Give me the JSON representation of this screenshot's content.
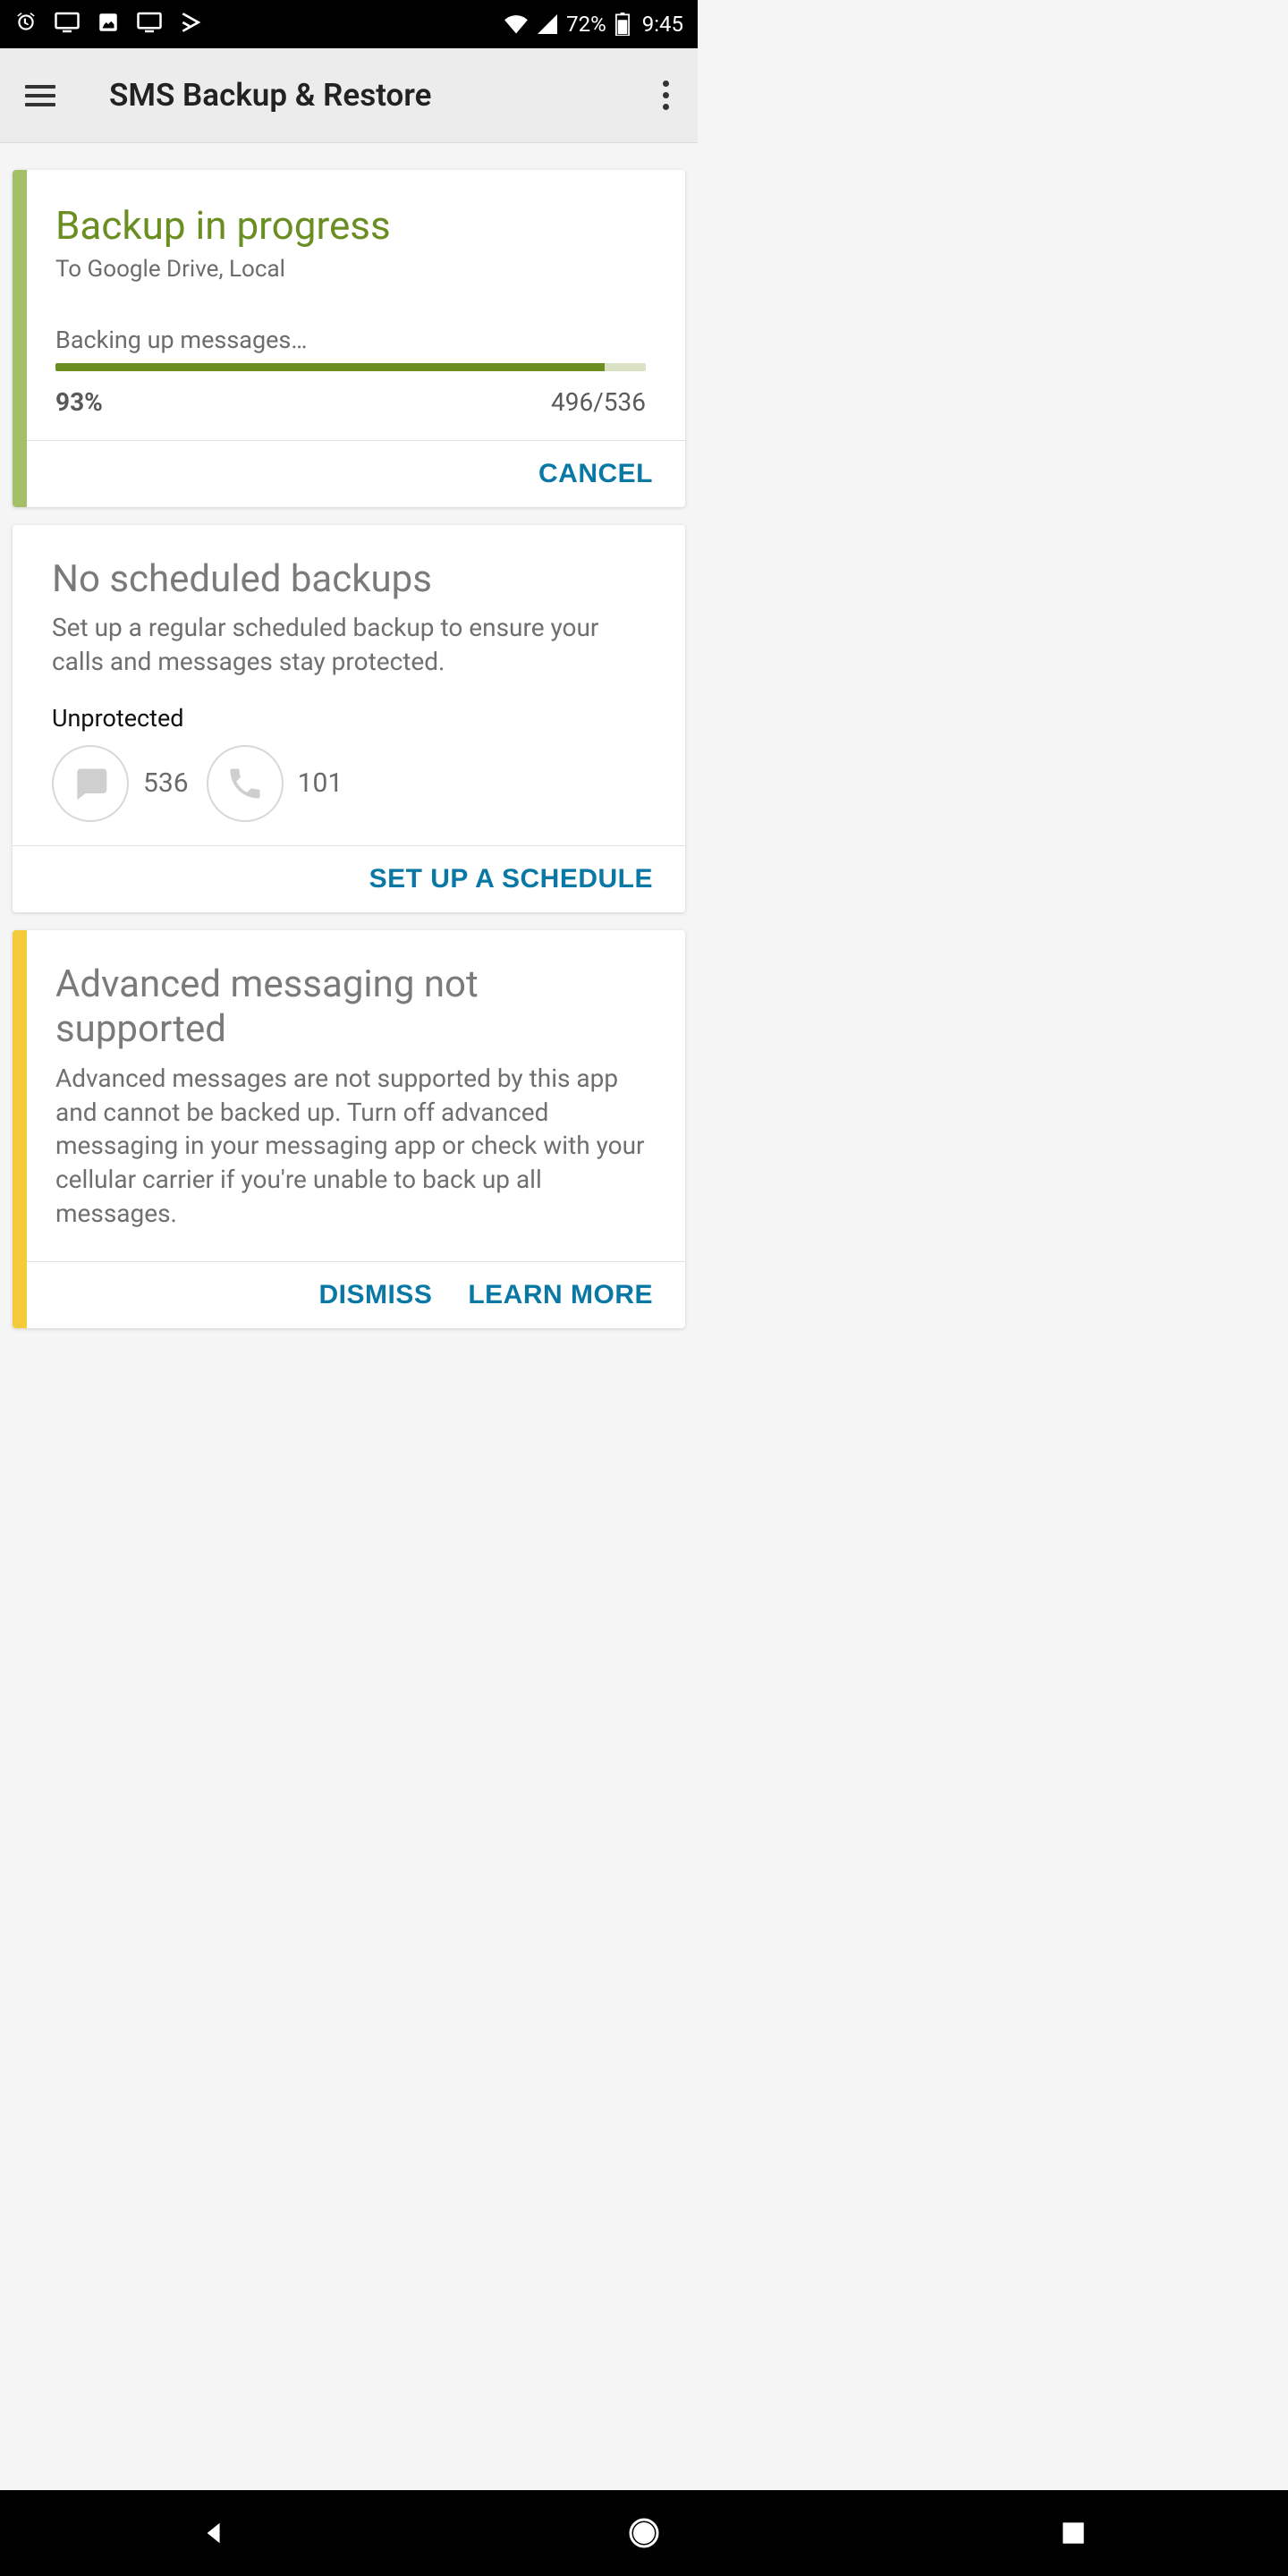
{
  "status": {
    "battery_pct": "72%",
    "time": "9:45"
  },
  "appbar": {
    "title": "SMS Backup & Restore"
  },
  "backup_card": {
    "title": "Backup in progress",
    "destination": "To Google Drive, Local",
    "state_text": "Backing up messages…",
    "percent": "93%",
    "progress_value": 93,
    "count_text": "496/536",
    "cancel_label": "CANCEL"
  },
  "schedule_card": {
    "title": "No scheduled backups",
    "description": "Set up a regular scheduled backup to ensure your calls and messages stay protected.",
    "unprotected_label": "Unprotected",
    "messages_count": "536",
    "calls_count": "101",
    "action_label": "SET UP A SCHEDULE"
  },
  "advanced_card": {
    "title": "Advanced messaging not supported",
    "description": "Advanced messages are not supported by this app and cannot be backed up. Turn off advanced messaging in your messaging app or check with your cellular carrier if you're unable to back up all messages.",
    "dismiss_label": "DISMISS",
    "learn_more_label": "LEARN MORE"
  }
}
